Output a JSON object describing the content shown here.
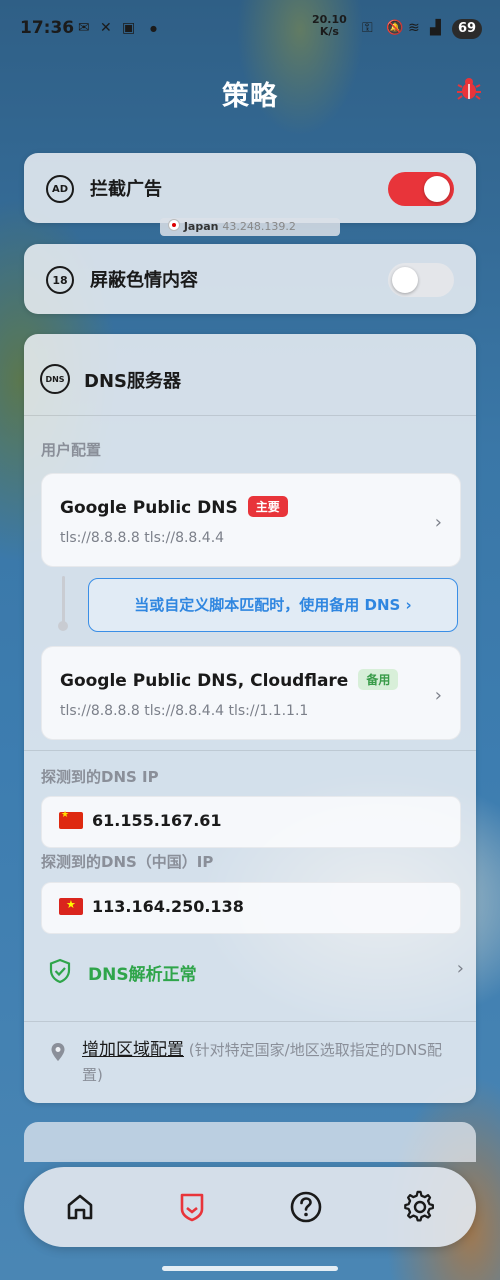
{
  "status_bar": {
    "time": "17:36",
    "net_speed_value": "20.10",
    "net_speed_unit": "K/s",
    "battery": "69"
  },
  "header": {
    "title": "策略"
  },
  "overlay": {
    "country": "Japan",
    "ip": "43.248.139.2"
  },
  "toggles": [
    {
      "icon_text": "AD",
      "label": "拦截广告",
      "state": "on"
    },
    {
      "icon_text": "18",
      "label": "屏蔽色情内容",
      "state": "off"
    }
  ],
  "dns": {
    "icon_text": "DNS",
    "title": "DNS服务器",
    "user_config_label": "用户配置",
    "primary": {
      "name": "Google Public DNS",
      "badge": "主要",
      "addresses": "tls://8.8.8.8 tls://8.8.4.4"
    },
    "fallback_link": "当或自定义脚本匹配时，使用备用 DNS ›",
    "backup": {
      "name": "Google Public DNS, Cloudflare",
      "badge": "备用",
      "addresses": "tls://8.8.8.8 tls://8.8.4.4 tls://1.1.1.1"
    },
    "detected_ip_label": "探测到的DNS IP",
    "detected_ip": "61.155.167.61",
    "detected_cn_label": "探测到的DNS（中国）IP",
    "detected_cn_ip": "113.164.250.138",
    "status": "DNS解析正常",
    "add_region_link": "增加区域配置",
    "add_region_hint": "(针对特定国家/地区选取指定的DNS配置)"
  },
  "colors": {
    "accent_red": "#e8343a",
    "accent_blue": "#2f86e0",
    "ok_green": "#2fa54a"
  }
}
